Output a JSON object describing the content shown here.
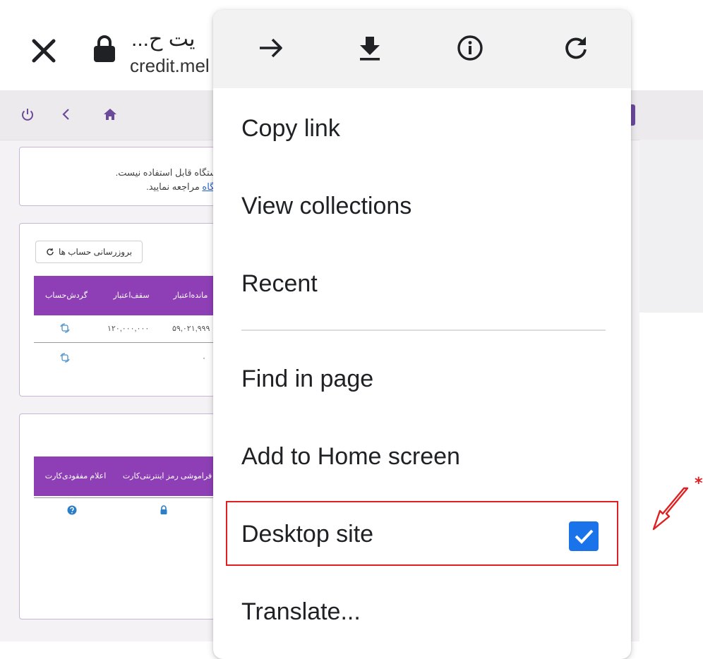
{
  "browser": {
    "title_partial": "...یت ح",
    "url_partial": "credit.mel"
  },
  "site": {
    "notice": {
      "line1": "ستگاه قابل استفاده نیست.",
      "line2_link": "تگاه",
      "line2_rest": " مراجعه نمایید."
    },
    "accounts": {
      "refresh_label": "بروزرسانی حساب ها",
      "headers": [
        {
          "line1": "گردش",
          "line2": "حساب"
        },
        {
          "line1": "سقف",
          "line2": "اعتبار"
        },
        {
          "line1": "مانده",
          "line2": "اعتبار"
        }
      ],
      "rows": [
        {
          "credit_limit": "۱۲۰,۰۰۰,۰۰۰",
          "balance": "۵۹,۰۲۱,۹۹۹"
        },
        {
          "credit_limit": "",
          "balance": "۰"
        }
      ]
    },
    "cards": {
      "headers": [
        {
          "line1": "اعلام مفقودی",
          "line2": "کارت"
        },
        {
          "line1": "فراموشی رمز اینترنتی",
          "line2": "کارت"
        }
      ]
    }
  },
  "menu": {
    "toolbar": [
      "forward-icon",
      "download-icon",
      "info-icon",
      "refresh-icon"
    ],
    "items": {
      "copy_link": "Copy link",
      "view_collections": "View collections",
      "recent": "Recent",
      "find_in_page": "Find in page",
      "add_to_home": "Add to Home screen",
      "desktop_site": "Desktop site",
      "translate": "Translate..."
    },
    "desktop_site_checked": true
  },
  "annotation": {
    "marker": "*",
    "highlight_color": "#e02020"
  },
  "colors": {
    "table_header": "#8e3fb6",
    "checkbox": "#1a73e8",
    "link": "#2a62c9"
  }
}
